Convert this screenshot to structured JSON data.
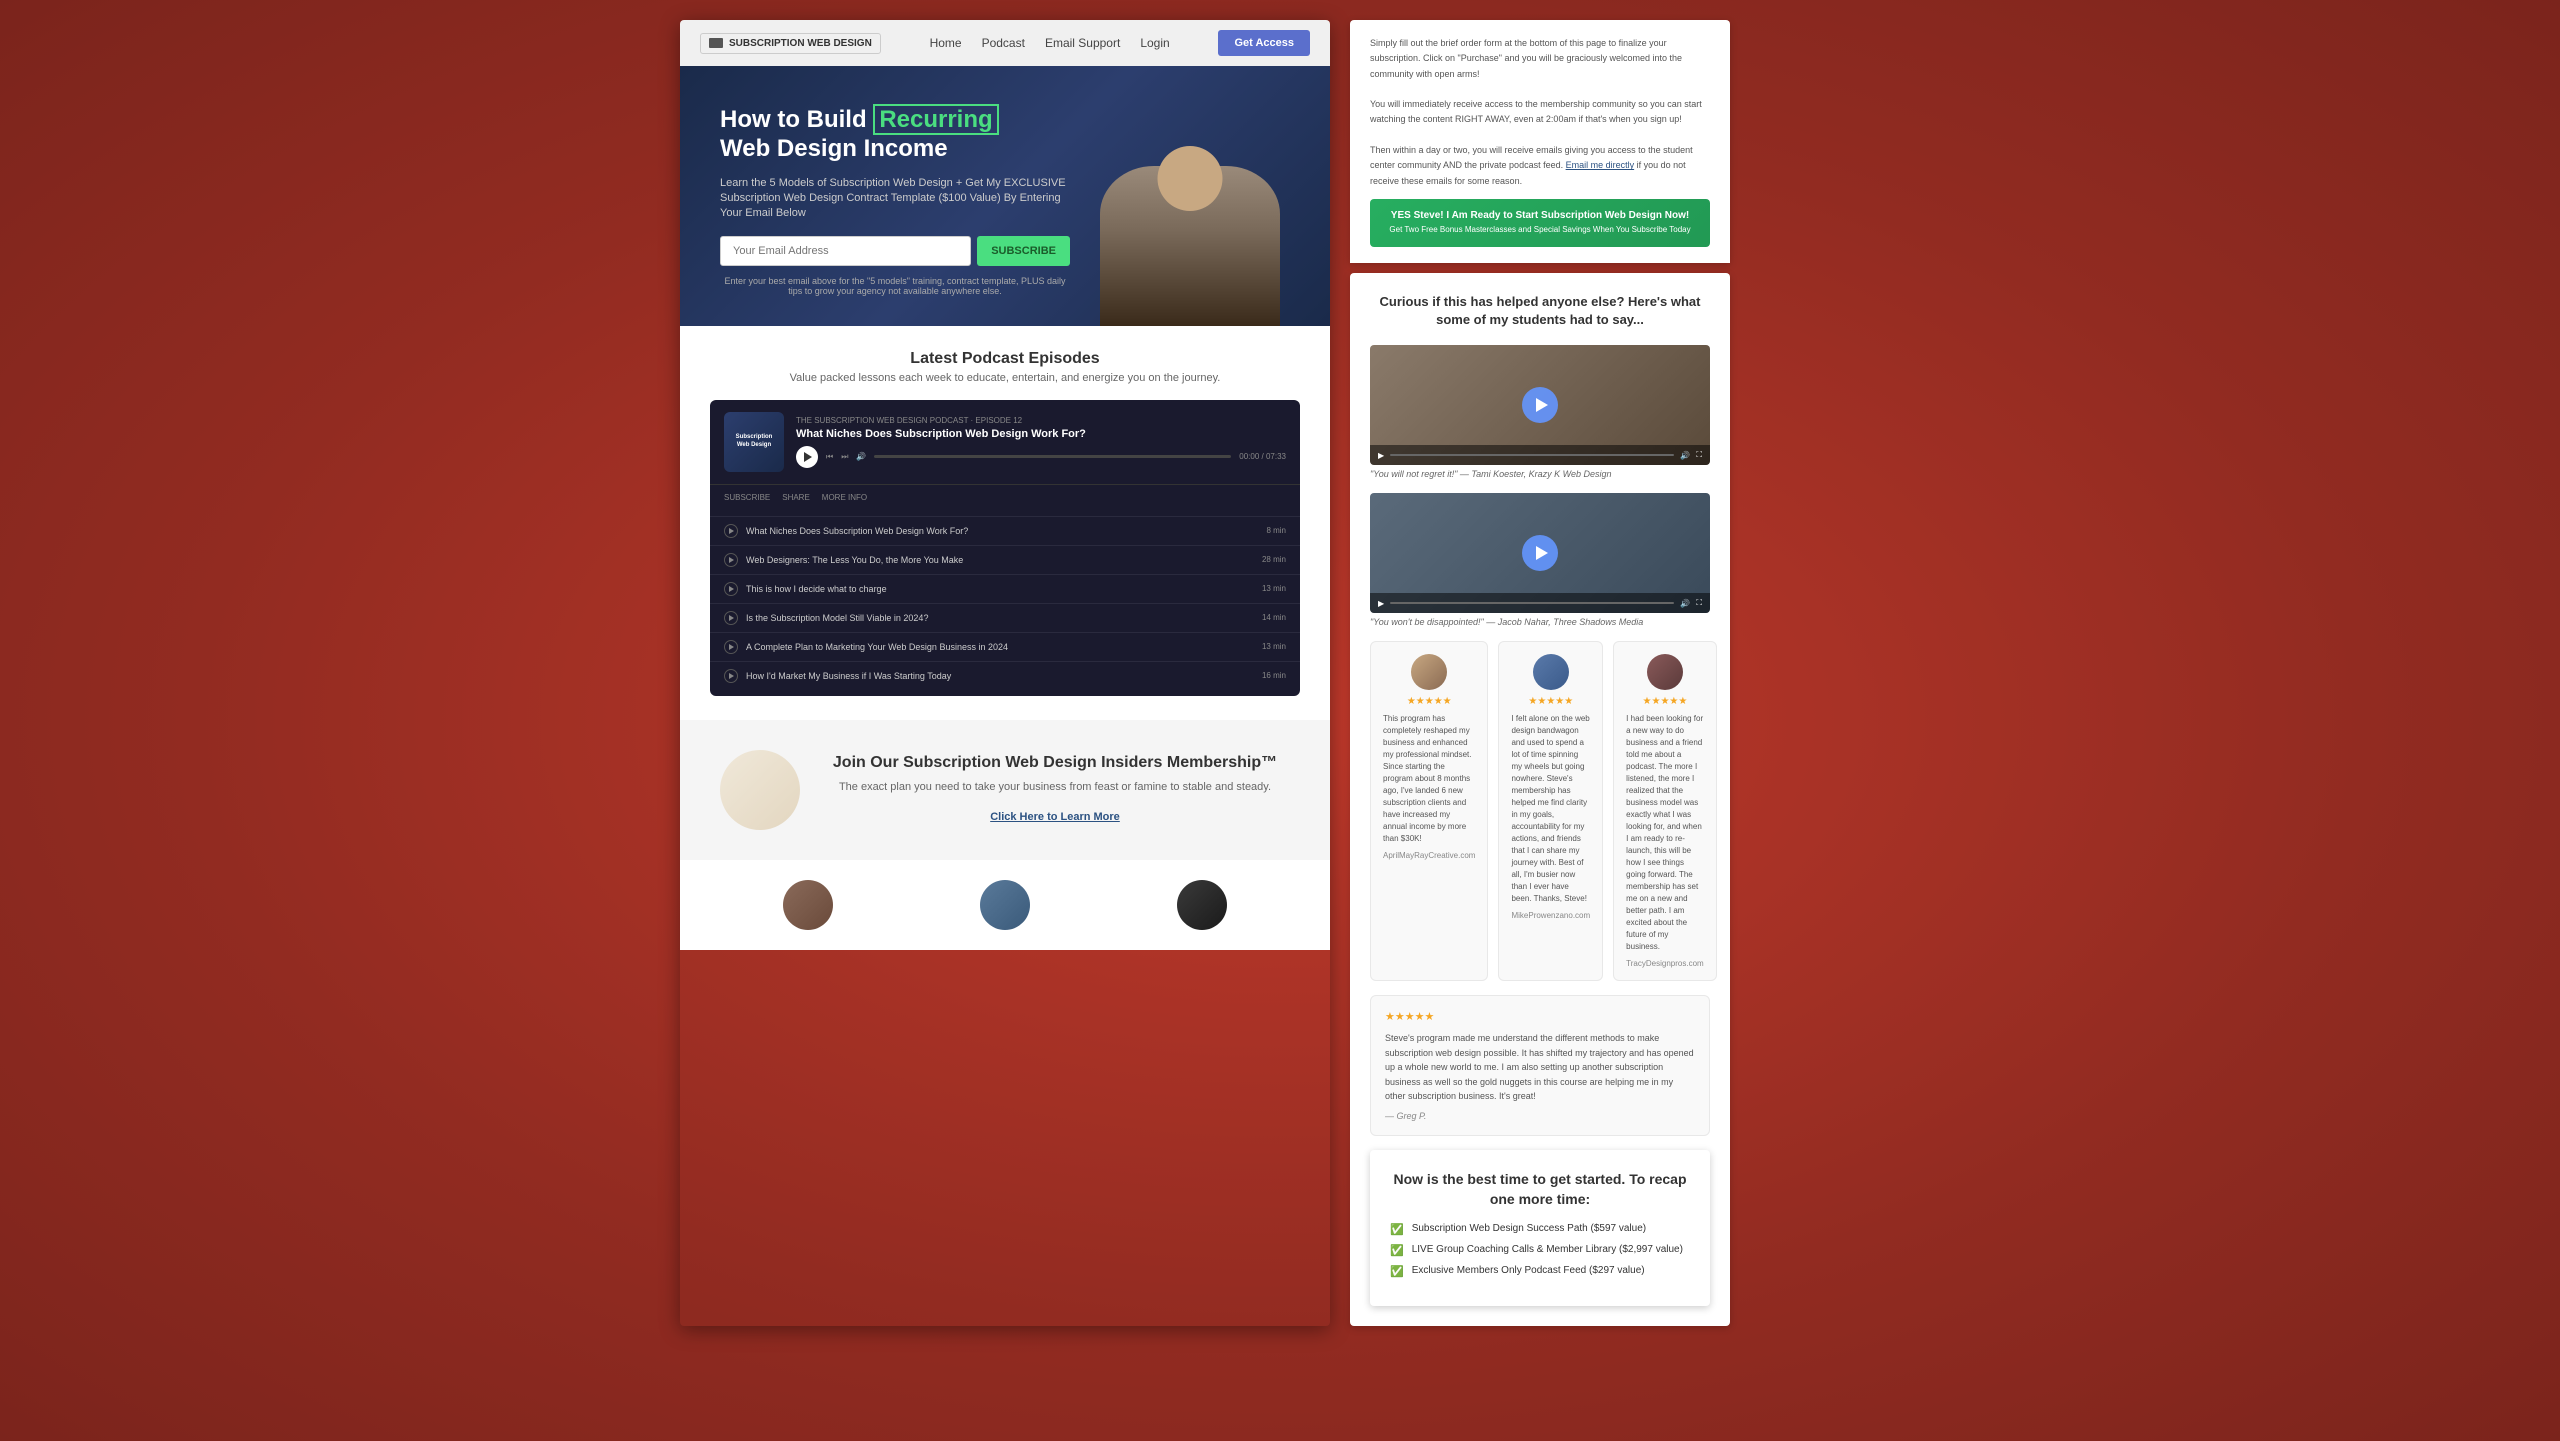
{
  "page": {
    "title": "Subscription Web Design"
  },
  "navbar": {
    "brand": "SUBSCRIPTION WEB DESIGN",
    "links": [
      "Home",
      "Podcast",
      "Email Support",
      "Login"
    ],
    "cta": "Get Access"
  },
  "hero": {
    "title_line1": "How to Build ",
    "title_highlight": "Recurring",
    "title_line2": "Web Design Income",
    "subtitle": "Learn the 5 Models of Subscription Web Design + Get My EXCLUSIVE Subscription Web Design Contract Template ($100 Value) By Entering Your Email Below",
    "email_placeholder": "Your Email Address",
    "subscribe_btn": "SUBSCRIBE",
    "fine_print": "Enter your best email above for the \"5 models\" training, contract template, PLUS daily tips to grow your agency not available anywhere else."
  },
  "podcast": {
    "section_title": "Latest Podcast Episodes",
    "section_subtitle": "Value packed lessons each week to educate, entertain, and energize you on the journey.",
    "current_episode": {
      "label": "THE SUBSCRIPTION WEB DESIGN PODCAST · EPISODE 12",
      "title": "What Niches Does Subscription Web Design Work For?",
      "time": "00:00 / 07:33"
    },
    "actions": [
      "SUBSCRIBE",
      "SHARE",
      "MORE INFO"
    ],
    "episodes": [
      {
        "title": "What Niches Does Subscription Web Design Work For?",
        "duration": "8 min"
      },
      {
        "title": "Web Designers: The Less You Do, the More You Make",
        "duration": "28 min"
      },
      {
        "title": "This is how I decide what to charge",
        "duration": "13 min"
      },
      {
        "title": "Is the Subscription Model Still Viable in 2024?",
        "duration": "14 min"
      },
      {
        "title": "A Complete Plan to Marketing Your Web Design Business in 2024",
        "duration": "13 min"
      },
      {
        "title": "How I'd Market My Business if I Was Starting Today",
        "duration": "16 min"
      }
    ]
  },
  "membership": {
    "title": "Join Our Subscription Web Design Insiders Membership™",
    "desc": "The exact plan you need to take your business from feast or famine to stable and steady.",
    "cta": "Click Here to Learn More"
  },
  "right_panel": {
    "intro_text": "Simply fill out the brief order form at the bottom of this page to finalize your subscription. Click on \"Purchase\" and you will be graciously welcomed into the community with open arms!\n\nYou will immediately receive access to the membership community so you can start watching the content RIGHT AWAY, even at 2:00am if that's when you sign up!\n\nThen within a day or two, you will receive emails giving you access to the student center community AND the private podcast feed. Email me directly if you do not receive these emails for some reason.",
    "cta_btn": "YES Steve! I Am Ready to Start Subscription Web Design Now!",
    "cta_sub": "Get Two Free Bonus Masterclasses and Special Savings When You Subscribe Today",
    "testimonials_title": "Curious if this has helped anyone else? Here's what some of my students had to say...",
    "video_testimonials": [
      {
        "caption": "\"You will not regret it!\" — Tami Koester, Krazy K Web Design"
      },
      {
        "caption": "\"You won't be disappointed!\" — Jacob Nahar, Three Shadows Media"
      }
    ],
    "text_testimonials": [
      {
        "text": "This program has completely reshaped my business and enhanced my professional mindset. Since starting the program about 8 months ago, I've landed 6 new subscription clients and have increased my annual income by more than $30K!",
        "author": "AprilMayRayCreative.com"
      },
      {
        "text": "I felt alone on the web design bandwagon and used to spend a lot of time spinning my wheels but going nowhere. Steve's membership has helped me find clarity in my goals, accountability for my actions, and friends that I can share my journey with. Best of all, I'm busier now than I ever have been. Thanks, Steve!",
        "author": "MikeProwenzano.com"
      },
      {
        "text": "I had been looking for a new way to do business and a friend told me about a podcast. The more I listened, the more I realized that the business model was exactly what I was looking for, and when I am ready to re-launch, this will be how I see things going forward. The membership has set me on a new and better path. I am excited about the future of my business.",
        "author": "TracyDesignpros.com"
      }
    ],
    "large_testimonial": {
      "text": "Steve's program made me understand the different methods to make subscription web design possible. It has shifted my trajectory and has opened up a whole new world to me. I am also setting up another subscription business as well so the gold nuggets in this course are helping me in my other subscription business. It's great!",
      "author": "— Greg P."
    },
    "recap_title": "Now is the best time to get started. To recap one more time:",
    "recap_items": [
      "Subscription Web Design Success Path ($597 value)",
      "LIVE Group Coaching Calls & Member Library ($2,997 value)",
      "Exclusive Members Only Podcast Feed ($297 value)"
    ]
  }
}
